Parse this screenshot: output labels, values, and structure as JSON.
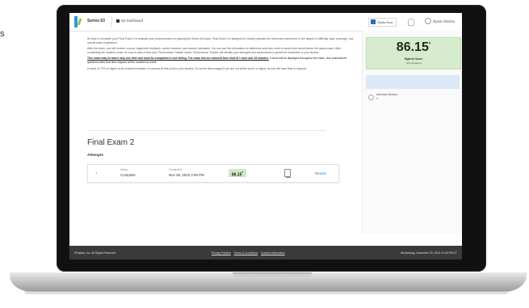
{
  "edge_glyph": "s",
  "header": {
    "app_title": "Series 63",
    "dashboard_label": "My Dashboard",
    "study_button": "Study Now",
    "user_label": "Mystic Wiesha"
  },
  "intro": {
    "p1": "It's time to complete your Final Exam 2 to evaluate your preparedness for passing the Series 63 exam. Final Exam 2 is designed to closely replicate the real exam experience to the degree of difficulty, topic coverage, and overall exam experience.",
    "p2": "After the exam, you will receive a score, diagnostic feedback, correct answers, and answer rationales. You can use this information to determine what you need to study more about before the actual exam. After completing the mastery exam, be sure to also review your Performance Tracker report. Performance Tracker will identify your strengths and weaknesses to guide the remainder of your studies.",
    "p3_bold": "This exam may be taken only one time and must be completed in one sitting. The exam has an enforced time limit of 1 hour and 15 minutes.",
    "p3_rest": " A clock will be displayed throughout the exam. Any unanswered questions after that time elapses will be marked incorrect.",
    "p4": "A score of 72% or higher is an excellent indicator of success at this point in your studies. Do not be discouraged if you are not at this score or higher, as you will have time to improve."
  },
  "exam": {
    "title": "Final Exam 2",
    "attempts_heading": "Attempts",
    "attempt": {
      "number": "1",
      "status_label": "Status",
      "status_value": "Complete",
      "completion_label": "Completion",
      "completion_value": "Nov 28, 2023 2:56 PM",
      "score": "86.15",
      "score_mark": "*",
      "review_label": "Review"
    }
  },
  "sidebar": {
    "highest_score": "86.15",
    "highest_score_mark": "*",
    "highest_score_label": "Highest Score",
    "required_label": "72% Required",
    "attempts_label": "Attempts Allowed",
    "attempts_value": "1"
  },
  "footer": {
    "copyright": "©Kaplan, Inc. All Rights Reserved.",
    "links": [
      "Privacy Policies",
      "Terms & Conditions",
      "Contact Information"
    ],
    "datetime": "Wednesday, November 29, 2023 12:48 PM CT"
  },
  "colors": {
    "score_green": "#d6eccd",
    "accent_blue": "#2a7fc1",
    "footer_bg": "#3a3a3a"
  }
}
